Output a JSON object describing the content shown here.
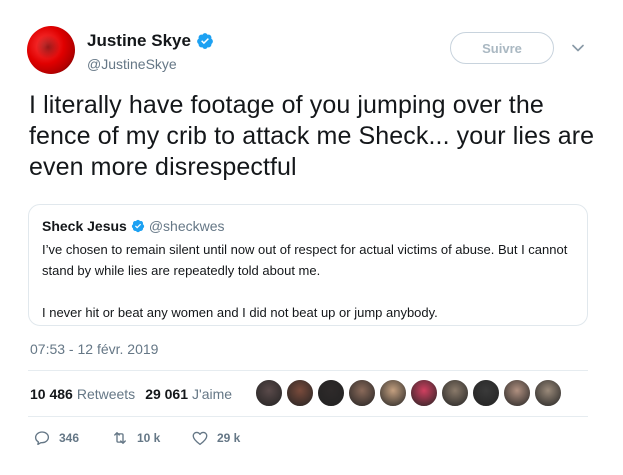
{
  "author": {
    "name": "Justine Skye",
    "handle": "@JustineSkye",
    "verified": true
  },
  "follow_button": {
    "label": "Suivre"
  },
  "tweet": {
    "text": "I literally have footage of you jumping over the fence of my crib to attack me Sheck... your lies are even more disrespectful",
    "timestamp": "07:53 - 12 févr. 2019"
  },
  "quoted_tweet": {
    "name": "Sheck Jesus",
    "handle": "@sheckwes",
    "verified": true,
    "paragraphs": [
      "I’ve chosen to remain silent until now out of respect for actual victims of abuse.  But I cannot stand by while lies are repeatedly told about me.",
      "I never hit or beat any women and I did not beat up or jump anybody."
    ]
  },
  "stats": {
    "retweets_count": "10 486",
    "retweets_label": "Retweets",
    "likes_count": "29 061",
    "likes_label": "J'aime"
  },
  "liker_avatars": [
    "#5a4a4a",
    "#7a4b3c",
    "#2e2a2a",
    "#8a6a5a",
    "#c4a080",
    "#d04060",
    "#8a7a6a",
    "#3a3a3a",
    "#b09080",
    "#9a8a7a"
  ],
  "actions": {
    "reply_count": "346",
    "retweet_count": "10 k",
    "like_count": "29 k"
  },
  "colors": {
    "verified_blue": "#1da1f2",
    "secondary_text": "#657786",
    "border": "#e1e8ed"
  }
}
